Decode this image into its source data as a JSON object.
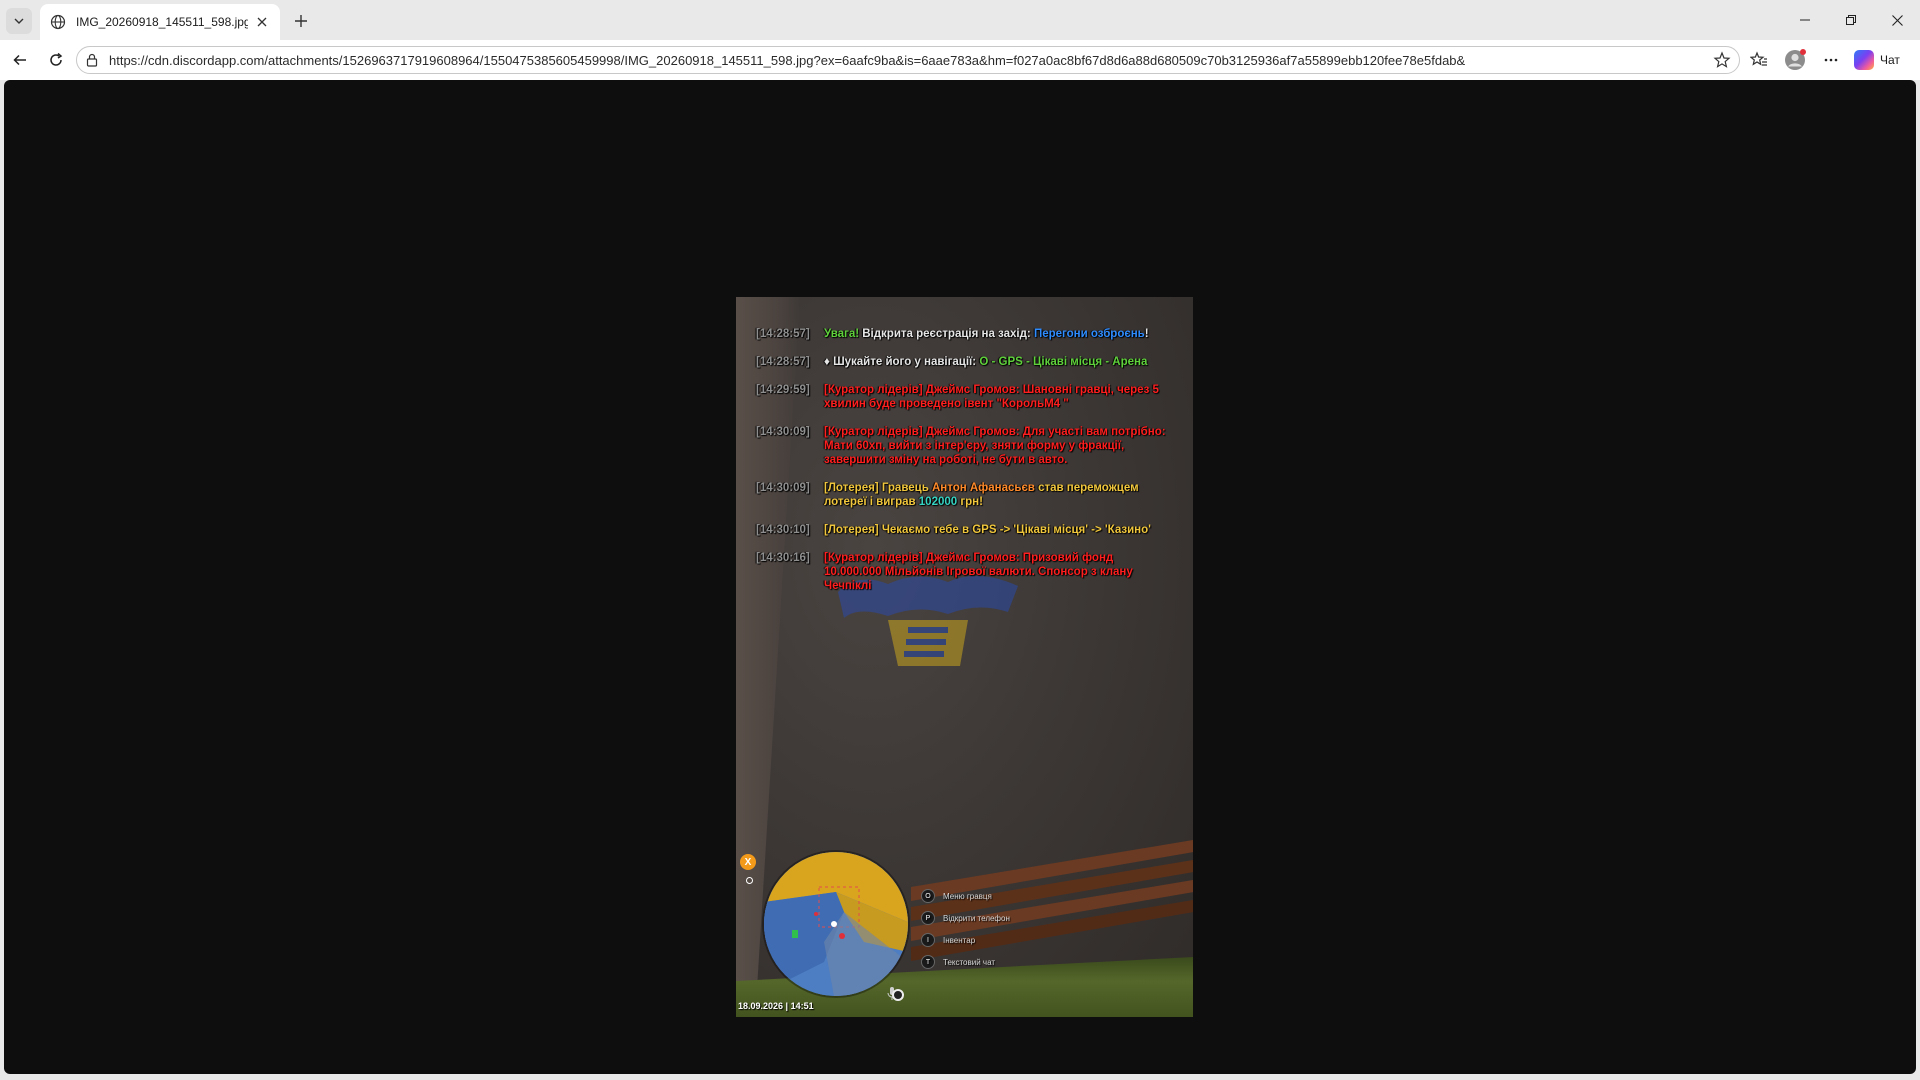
{
  "browser": {
    "tab": {
      "title": "IMG_20260918_145511_598.jpg (4"
    },
    "address": {
      "url": "https://cdn.discordapp.com/attachments/1526963717919608964/1550475385605459998/IMG_20260918_145511_598.jpg?ex=6aafc9ba&is=6aae783a&hm=f027a0ac8bf67d8d6a88d680509c70b3125936af7a55899ebb120fee78e5fdab&"
    },
    "chat_label": "Чат"
  },
  "game": {
    "chat": [
      {
        "ts": "[14:28:57]",
        "parts": [
          {
            "text": "Увага! ",
            "color": "green"
          },
          {
            "text": "Відкрита реєстрація на захід: ",
            "color": "white"
          },
          {
            "text": "Перегони озброєнь",
            "color": "blue"
          },
          {
            "text": "!",
            "color": "white"
          }
        ]
      },
      {
        "ts": "[14:28:57]",
        "parts": [
          {
            "text": "♦ Шукайте його у навігації: ",
            "color": "white"
          },
          {
            "text": "O - GPS - Цікаві місця - Арена",
            "color": "green"
          }
        ]
      },
      {
        "ts": "[14:29:59]",
        "parts": [
          {
            "text": "[Куратор лідерів] Джеймс Громов: Шановні гравці, через 5 хвилин буде проведено івент \"КорольМ4 \"",
            "color": "red"
          }
        ]
      },
      {
        "ts": "[14:30:09]",
        "parts": [
          {
            "text": "[Куратор лідерів] Джеймс Громов: Для участі вам потрібно: Мати 60хп, вийти з інтер'єру, зняти форму у фракції, завершити зміну на роботі, не бути в авто.",
            "color": "red"
          }
        ]
      },
      {
        "ts": "[14:30:09]",
        "parts": [
          {
            "text": "[Лотерея] Гравець ",
            "color": "yellow"
          },
          {
            "text": "Антон Афанасьєв",
            "color": "orange"
          },
          {
            "text": " став переможцем лотереї і виграв ",
            "color": "yellow"
          },
          {
            "text": "102000",
            "color": "cyan"
          },
          {
            "text": " грн!",
            "color": "yellow"
          }
        ]
      },
      {
        "ts": "[14:30:10]",
        "parts": [
          {
            "text": "[Лотерея] Чекаємо тебе в GPS -> 'Цікаві місця' -> 'Казино'",
            "color": "yellow"
          }
        ]
      },
      {
        "ts": "[14:30:16]",
        "parts": [
          {
            "text": "[Куратор лідерів] Джеймс Громов: Призовий фонд 10.000.000 Мільйонів Ігрової валюти. Спонсор з клану Чечпіклі",
            "color": "red"
          }
        ]
      }
    ],
    "hints": [
      {
        "key": "O",
        "label": "Меню гравця"
      },
      {
        "key": "P",
        "label": "Відкрити телефон"
      },
      {
        "key": "I",
        "label": "Інвентар"
      },
      {
        "key": "T",
        "label": "Текстовий чат"
      }
    ],
    "badge": "X",
    "datetime": "18.09.2026 | 14:51"
  },
  "colors": {
    "green": "#5fd13b",
    "white": "#e6e6e6",
    "blue": "#2f8cff",
    "red": "#ff1f1f",
    "yellow": "#f0c63c",
    "orange": "#ff8a2a",
    "cyan": "#36d3c2"
  }
}
